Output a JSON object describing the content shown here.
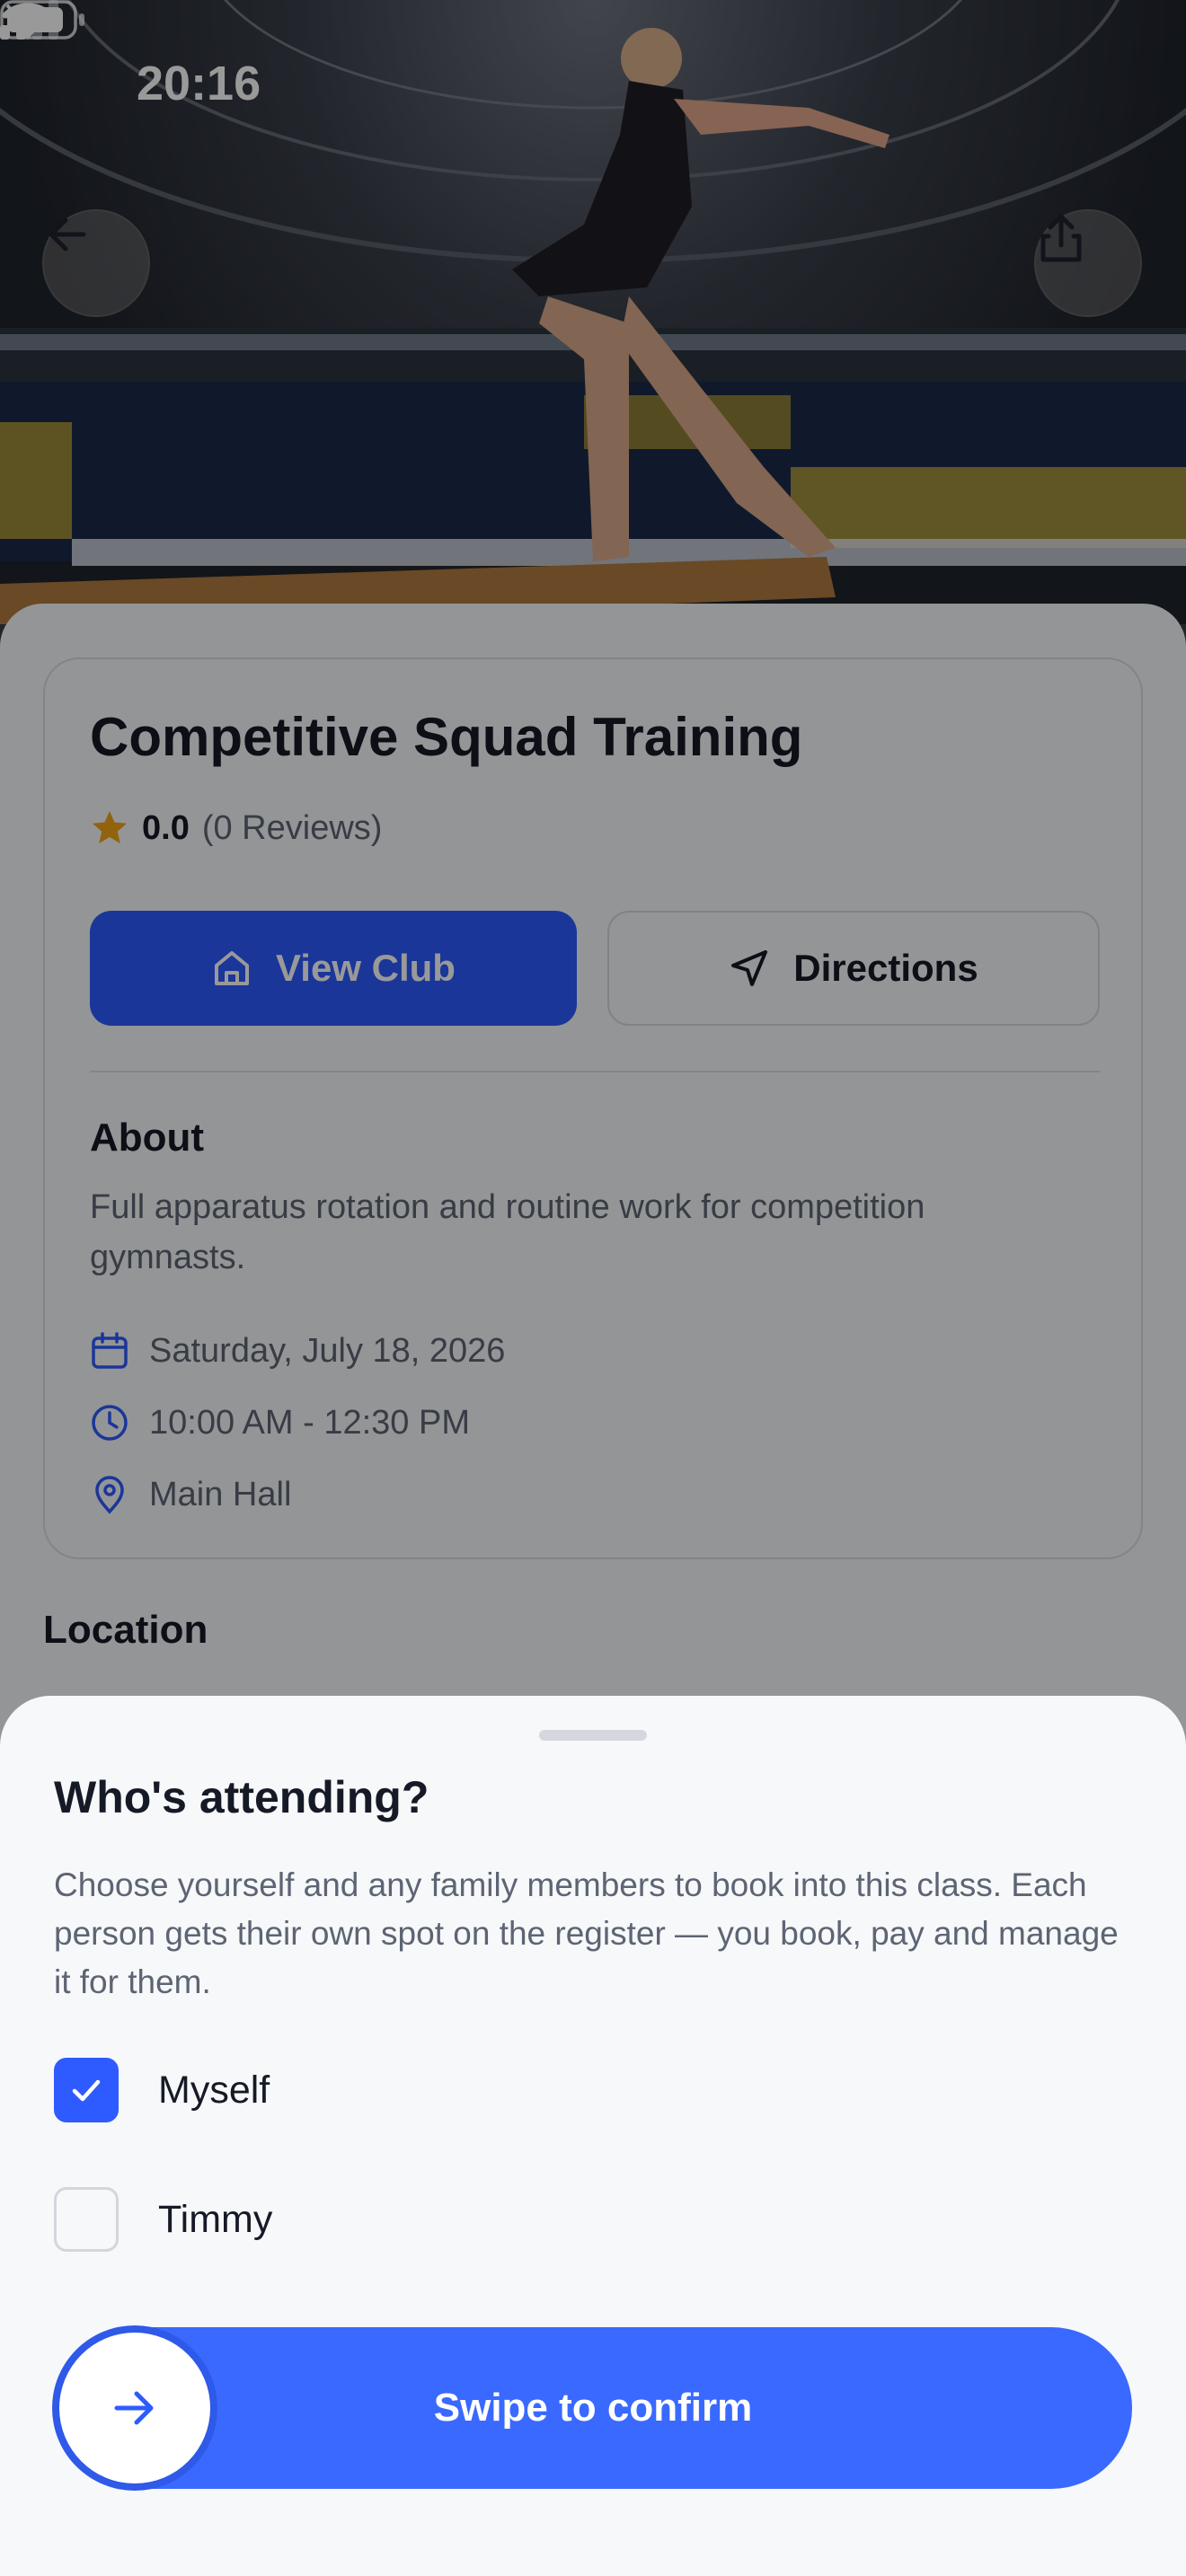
{
  "status_bar": {
    "time": "20:16",
    "icons": [
      "bell-slash-icon",
      "cellular-signal-icon",
      "wifi-icon",
      "battery-icon"
    ]
  },
  "header": {
    "back_icon": "arrow-left-icon",
    "share_icon": "share-icon"
  },
  "class": {
    "title": "Competitive Squad Training",
    "rating_score": "0.0",
    "rating_count": "(0 Reviews)",
    "view_club_label": "View Club",
    "directions_label": "Directions",
    "about_heading": "About",
    "about_text": "Full apparatus rotation and routine work for competition gymnasts.",
    "date": "Saturday, July 18, 2026",
    "time": "10:00 AM - 12:30 PM",
    "place": "Main Hall",
    "location_heading": "Location"
  },
  "sheet": {
    "title": "Who's attending?",
    "description": "Choose yourself and any family members to book into this class. Each person gets their own spot on the register — you book, pay and manage it for them.",
    "options": [
      {
        "label": "Myself",
        "checked": true
      },
      {
        "label": "Timmy",
        "checked": false
      }
    ],
    "swipe_label": "Swipe to confirm"
  },
  "colors": {
    "accent": "#2e5bff",
    "star": "#f2a516",
    "text_primary": "#151a26",
    "text_secondary": "#5d6473"
  }
}
